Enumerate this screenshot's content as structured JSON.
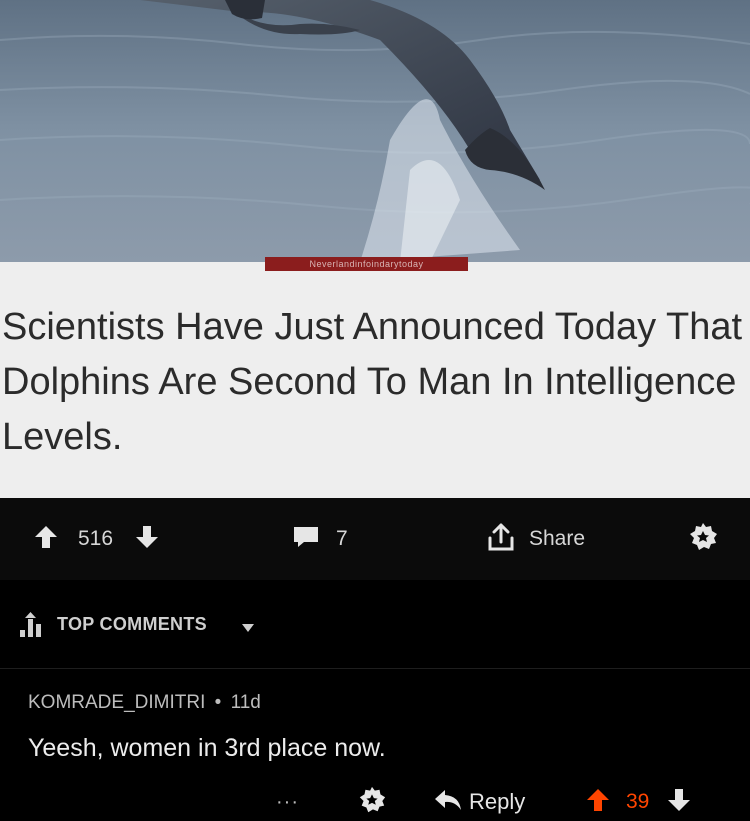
{
  "post": {
    "source_tag": "Neverlandinfoindarytoday",
    "headline": "Scientists Have Just Announced Today That Dolphins Are Second To Man In Intelligence Levels."
  },
  "action_bar": {
    "upvotes": "516",
    "comments": "7",
    "share_label": "Share"
  },
  "comments_header": {
    "sort_label": "TOP COMMENTS"
  },
  "comment": {
    "author": "KOMRADE_DIMITRI",
    "separator": "•",
    "age": "11d",
    "body": "Yeesh, women in 3rd place now.",
    "more": "···",
    "reply_label": "Reply",
    "score": "39"
  },
  "colors": {
    "upvote_active": "#ff4500",
    "background": "#000000",
    "headline_bg": "#eeeeee"
  },
  "icons": [
    "upvote-icon",
    "downvote-icon",
    "comment-icon",
    "share-icon",
    "award-icon",
    "top-sort-icon",
    "chevron-down-icon",
    "reply-icon",
    "more-icon"
  ]
}
